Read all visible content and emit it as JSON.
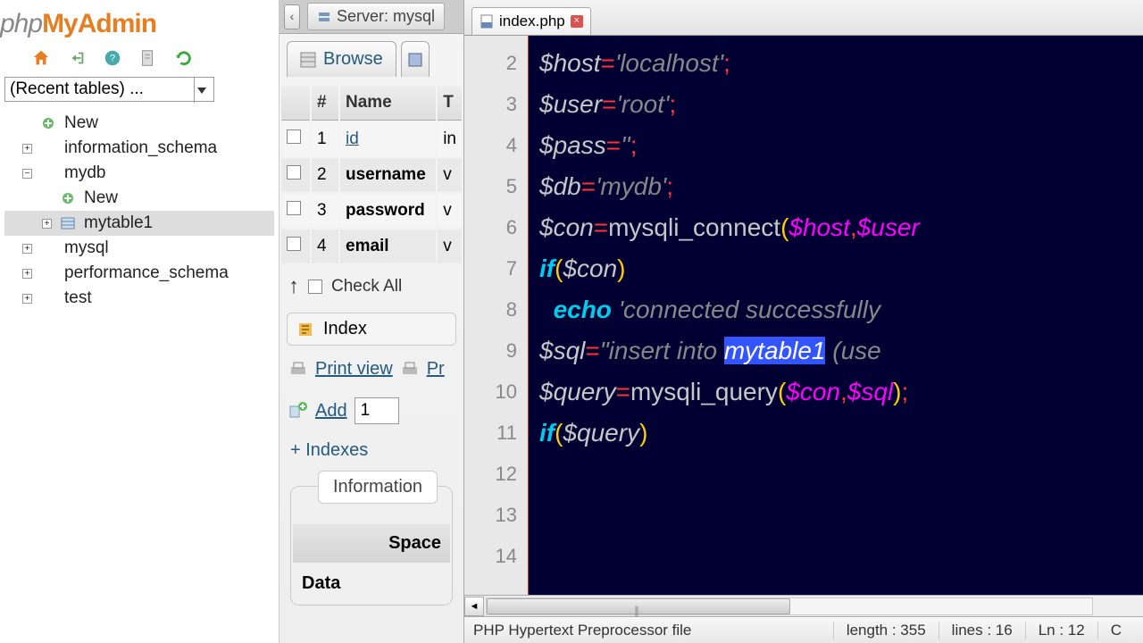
{
  "pma": {
    "logo": {
      "p1": "php",
      "p2": "MyAdmin"
    },
    "recent_placeholder": "(Recent tables) ...",
    "tree": [
      {
        "label": "New",
        "type": "new"
      },
      {
        "label": "information_schema",
        "type": "db"
      },
      {
        "label": "mydb",
        "type": "db",
        "expanded": true,
        "children": [
          {
            "label": "New",
            "type": "new"
          },
          {
            "label": "mytable1",
            "type": "table",
            "selected": true
          }
        ]
      },
      {
        "label": "mysql",
        "type": "db"
      },
      {
        "label": "performance_schema",
        "type": "db"
      },
      {
        "label": "test",
        "type": "db"
      }
    ]
  },
  "structure": {
    "server_crumb": "Server: mysql",
    "tab_browse": "Browse",
    "cols_header": {
      "num": "#",
      "name": "Name",
      "type": "T"
    },
    "cols": [
      {
        "n": "1",
        "name": "id",
        "t": "in"
      },
      {
        "n": "2",
        "name": "username",
        "t": "v"
      },
      {
        "n": "3",
        "name": "password",
        "t": "v"
      },
      {
        "n": "4",
        "name": "email",
        "t": "v"
      }
    ],
    "check_all": "Check All",
    "index": "Index",
    "print_view": "Print view",
    "pr": "Pr",
    "add": "Add",
    "add_value": "1",
    "indexes": "+ Indexes",
    "info_title": "Information",
    "space": "Space",
    "data": "Data"
  },
  "editor": {
    "tab_name": "index.php",
    "gutter_lines": [
      "2",
      "3",
      "4",
      "5",
      "6",
      "7",
      "8",
      "9",
      "10",
      "11",
      "12",
      "13",
      "14"
    ],
    "code_lines": [
      {
        "tokens": [
          {
            "c": "v",
            "t": ""
          }
        ]
      },
      {
        "tokens": [
          {
            "c": "v",
            "t": "$host"
          },
          {
            "c": "op",
            "t": "="
          },
          {
            "c": "s",
            "t": "'localhost'"
          },
          {
            "c": "op",
            "t": ";"
          }
        ]
      },
      {
        "tokens": [
          {
            "c": "v",
            "t": "$user"
          },
          {
            "c": "op",
            "t": "="
          },
          {
            "c": "s",
            "t": "'root'"
          },
          {
            "c": "op",
            "t": ";"
          }
        ]
      },
      {
        "tokens": [
          {
            "c": "v",
            "t": "$pass"
          },
          {
            "c": "op",
            "t": "="
          },
          {
            "c": "s",
            "t": "''"
          },
          {
            "c": "op",
            "t": ";"
          }
        ]
      },
      {
        "tokens": [
          {
            "c": "v",
            "t": "$db"
          },
          {
            "c": "op",
            "t": "="
          },
          {
            "c": "s",
            "t": "'mydb'"
          },
          {
            "c": "op",
            "t": ";"
          }
        ]
      },
      {
        "tokens": [
          {
            "c": "v",
            "t": ""
          }
        ]
      },
      {
        "tokens": [
          {
            "c": "v",
            "t": "$con"
          },
          {
            "c": "op",
            "t": "="
          },
          {
            "c": "fn",
            "t": "mysqli_connect"
          },
          {
            "c": "br",
            "t": "("
          },
          {
            "c": "sv",
            "t": "$host"
          },
          {
            "c": "op",
            "t": ","
          },
          {
            "c": "sv",
            "t": "$user"
          }
        ]
      },
      {
        "tokens": [
          {
            "c": "kw",
            "t": "if"
          },
          {
            "c": "br",
            "t": "("
          },
          {
            "c": "v",
            "t": "$con"
          },
          {
            "c": "br",
            "t": ")"
          }
        ]
      },
      {
        "tokens": [
          {
            "c": "v",
            "t": "  "
          },
          {
            "c": "kw",
            "t": "echo"
          },
          {
            "c": "v",
            "t": " "
          },
          {
            "c": "s",
            "t": "'connected successfully"
          }
        ]
      },
      {
        "tokens": [
          {
            "c": "v",
            "t": ""
          }
        ]
      },
      {
        "tokens": [
          {
            "c": "v",
            "t": "$sql"
          },
          {
            "c": "op",
            "t": "="
          },
          {
            "c": "s",
            "t": "\"insert into "
          },
          {
            "c": "sel",
            "t": "mytable1"
          },
          {
            "c": "s",
            "t": " (use"
          }
        ]
      },
      {
        "tokens": [
          {
            "c": "v",
            "t": "$query"
          },
          {
            "c": "op",
            "t": "="
          },
          {
            "c": "fn",
            "t": "mysqli_query"
          },
          {
            "c": "br",
            "t": "("
          },
          {
            "c": "sv",
            "t": "$con"
          },
          {
            "c": "op",
            "t": ","
          },
          {
            "c": "sv",
            "t": "$sql"
          },
          {
            "c": "br",
            "t": ")"
          },
          {
            "c": "op",
            "t": ";"
          }
        ]
      },
      {
        "tokens": [
          {
            "c": "kw",
            "t": "if"
          },
          {
            "c": "br",
            "t": "("
          },
          {
            "c": "v",
            "t": "$query"
          },
          {
            "c": "br",
            "t": ")"
          }
        ]
      }
    ],
    "status": {
      "filetype": "PHP Hypertext Preprocessor file",
      "length": "length : 355",
      "lines": "lines : 16",
      "ln": "Ln : 12",
      "col": "C"
    }
  }
}
